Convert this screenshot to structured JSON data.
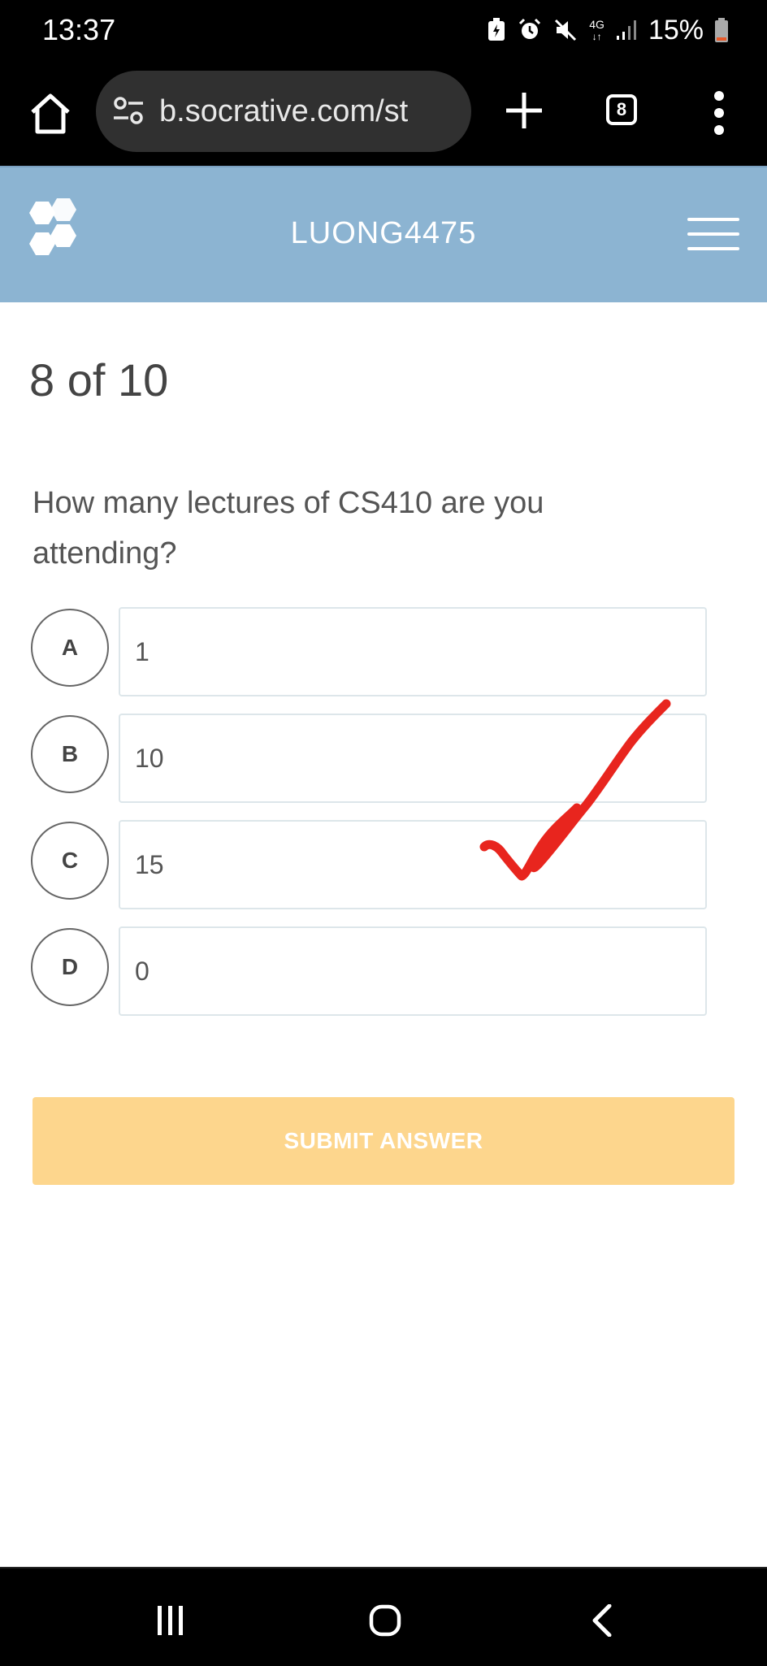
{
  "status_bar": {
    "time": "13:37",
    "network": "4G",
    "battery": "15%",
    "icons": [
      "battery-saver-icon",
      "alarm-icon",
      "mute-icon",
      "network-4g-icon",
      "signal-icon",
      "battery-icon"
    ]
  },
  "browser": {
    "url": "b.socrative.com/st",
    "tab_count": "8",
    "icons": [
      "home-icon",
      "site-settings-icon",
      "plus-icon",
      "tabs-icon",
      "more-vert-icon"
    ]
  },
  "header": {
    "room_name": "LUONG4475",
    "background": "#8cb4d2",
    "icons": [
      "socrative-logo",
      "hamburger-menu-icon"
    ]
  },
  "quiz": {
    "progress": "8 of 10",
    "question": "How many lectures of CS410 are you attending?",
    "options": [
      {
        "letter": "A",
        "text": "1"
      },
      {
        "letter": "B",
        "text": "10"
      },
      {
        "letter": "C",
        "text": "15"
      },
      {
        "letter": "D",
        "text": "0"
      }
    ],
    "submit_label": "SUBMIT ANSWER",
    "submit_color": "#fdd68d"
  },
  "annotation": {
    "check_mark_color": "#e8251e"
  },
  "nav_bar": {
    "icons": [
      "recent-apps-icon",
      "home-nav-icon",
      "back-icon"
    ]
  }
}
